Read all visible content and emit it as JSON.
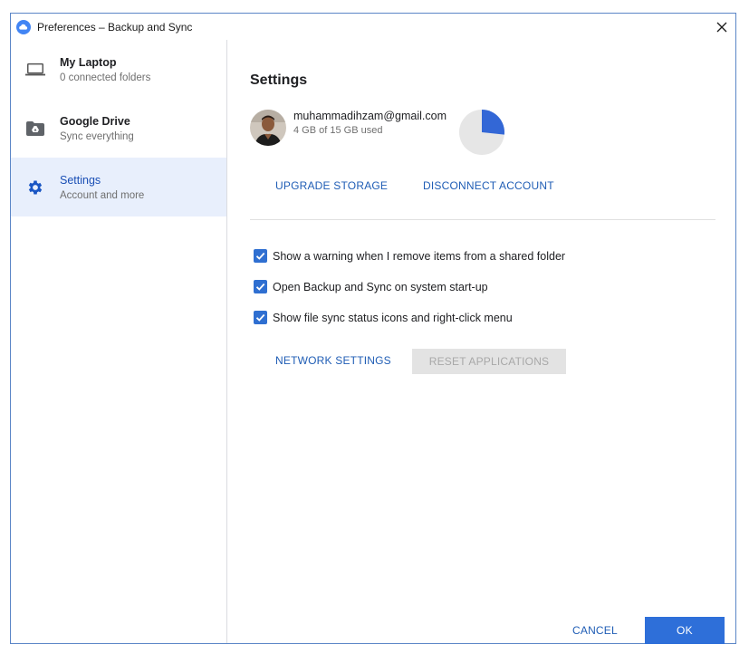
{
  "window": {
    "title": "Preferences – Backup and Sync",
    "app_icon": "backup-and-sync-cloud-icon",
    "close_icon": "close-icon"
  },
  "sidebar": {
    "items": [
      {
        "name": "My Laptop",
        "sub": "0 connected folders",
        "icon": "laptop-icon",
        "active": false
      },
      {
        "name": "Google Drive",
        "sub": "Sync everything",
        "icon": "drive-folder-icon",
        "active": false
      },
      {
        "name": "Settings",
        "sub": "Account and more",
        "icon": "gear-icon",
        "active": true
      }
    ]
  },
  "settings": {
    "title": "Settings",
    "account": {
      "email": "muhammadihzam@gmail.com",
      "usage": "4 GB of 15 GB used",
      "used_fraction": 0.2667
    },
    "upgrade_label": "UPGRADE STORAGE",
    "disconnect_label": "DISCONNECT ACCOUNT",
    "options": [
      {
        "label": "Show a warning when I remove items from a shared folder",
        "checked": true
      },
      {
        "label": "Open Backup and Sync on system start-up",
        "checked": true
      },
      {
        "label": "Show file sync status icons and right-click menu",
        "checked": true
      }
    ],
    "network_label": "NETWORK SETTINGS",
    "reset_label": "RESET APPLICATIONS"
  },
  "footer": {
    "cancel_label": "CANCEL",
    "ok_label": "OK"
  },
  "colors": {
    "accent": "#2e6fd9",
    "link": "#1f5db5",
    "active_bg": "#e8effc",
    "pie_used": "#3367d6",
    "pie_free": "#e6e6e6"
  }
}
